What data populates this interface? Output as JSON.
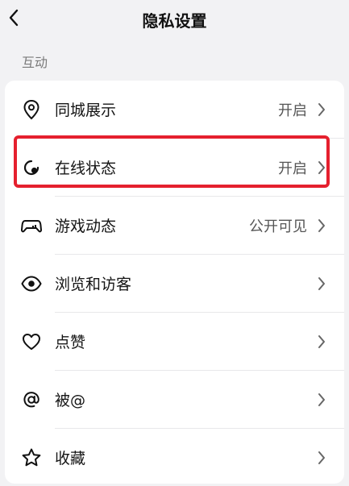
{
  "header": {
    "title": "隐私设置"
  },
  "section": {
    "label": "互动"
  },
  "rows": [
    {
      "label": "同城展示",
      "value": "开启",
      "icon": "location-pin-icon"
    },
    {
      "label": "在线状态",
      "value": "开启",
      "icon": "online-status-icon"
    },
    {
      "label": "游戏动态",
      "value": "公开可见",
      "icon": "game-controller-icon"
    },
    {
      "label": "浏览和访客",
      "value": "",
      "icon": "eye-icon"
    },
    {
      "label": "点赞",
      "value": "",
      "icon": "heart-icon"
    },
    {
      "label": "被@",
      "value": "",
      "icon": "at-icon"
    },
    {
      "label": "收藏",
      "value": "",
      "icon": "star-icon"
    }
  ],
  "colors": {
    "highlight": "#e5202e",
    "background": "#f2f2f4"
  }
}
